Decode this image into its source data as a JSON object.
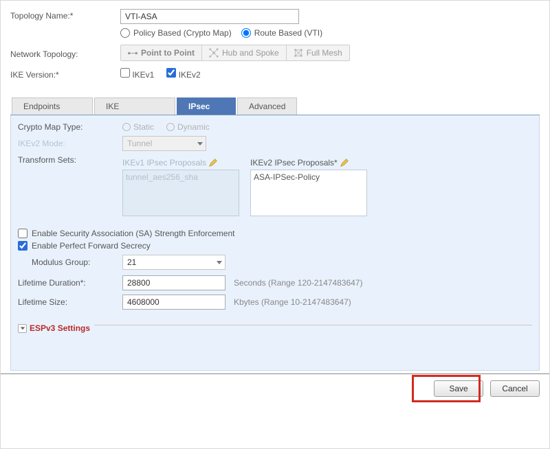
{
  "form": {
    "topology_name_label": "Topology Name:*",
    "topology_name_value": "VTI-ASA",
    "policy_radio": "Policy Based (Crypto Map)",
    "route_radio": "Route Based (VTI)",
    "network_topology_label": "Network Topology:",
    "seg_ptp": "Point to Point",
    "seg_hub": "Hub and Spoke",
    "seg_mesh": "Full Mesh",
    "ike_version_label": "IKE Version:*",
    "ikev1_label": "IKEv1",
    "ikev2_label": "IKEv2"
  },
  "tabs": {
    "endpoints": "Endpoints",
    "ike": "IKE",
    "ipsec": "IPsec",
    "advanced": "Advanced"
  },
  "ipsec": {
    "crypto_map_label": "Crypto Map Type:",
    "crypto_static": "Static",
    "crypto_dynamic": "Dynamic",
    "ikev2_mode_label": "IKEv2 Mode:",
    "ikev2_mode_value": "Tunnel",
    "transform_sets_label": "Transform Sets:",
    "ikev1_proposals_title": "IKEv1 IPsec Proposals",
    "ikev1_proposals_value": "tunnel_aes256_sha",
    "ikev2_proposals_title": "IKEv2 IPsec Proposals*",
    "ikev2_proposals_value": "ASA-IPSec-Policy",
    "sa_strength_label": "Enable Security Association (SA) Strength Enforcement",
    "pfs_label": "Enable Perfect Forward Secrecy",
    "modulus_group_label": "Modulus Group:",
    "modulus_group_value": "21",
    "lifetime_duration_label": "Lifetime Duration*:",
    "lifetime_duration_value": "28800",
    "lifetime_duration_help": "Seconds (Range 120-2147483647)",
    "lifetime_size_label": "Lifetime Size:",
    "lifetime_size_value": "4608000",
    "lifetime_size_help": "Kbytes (Range 10-2147483647)",
    "espv3_header": "ESPv3 Settings"
  },
  "footer": {
    "save": "Save",
    "cancel": "Cancel"
  }
}
